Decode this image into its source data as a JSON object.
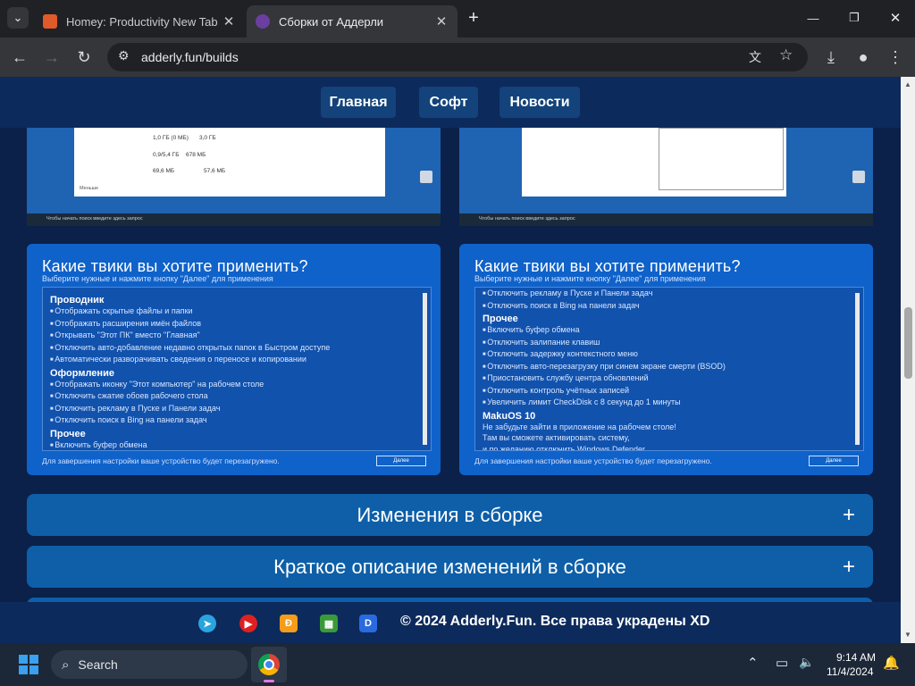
{
  "browser": {
    "tabs": [
      {
        "title": "Homey: Productivity New Tab"
      },
      {
        "title": "Сборки от Аддерли"
      }
    ],
    "url": "adderly.fun/builds"
  },
  "nav": {
    "items": [
      "Главная",
      "Софт",
      "Новости"
    ]
  },
  "screenshots_top": {
    "left": {
      "stats": [
        "1,0 ГБ (0 МБ)",
        "3,0 ГБ",
        "0,9/5,4 ГБ",
        "678 МБ",
        "69,6 МБ",
        "57,6 МБ"
      ],
      "link": "Меньше",
      "search_text": "Чтобы начать поиск введите здесь запрос"
    },
    "right": {
      "search_text": "Чтобы начать поиск введите здесь запрос"
    }
  },
  "cards": [
    {
      "title": "Какие твики вы хотите применить?",
      "subtitle": "Выберите нужные и нажмите кнопку \"Далее\" для применения",
      "sections": [
        {
          "heading": "Проводник",
          "items": [
            "Отображать скрытые файлы и папки",
            "Отображать расширения имён файлов",
            "Открывать \"Этот ПК\" вместо \"Главная\"",
            "Отключить авто-добавление недавно открытых папок в Быстром доступе",
            "Автоматически разворачивать сведения о переносе и копировании"
          ]
        },
        {
          "heading": "Оформление",
          "items": [
            "Отображать иконку \"Этот компьютер\" на рабочем столе",
            "Отключить сжатие обоев рабочего стола",
            "Отключить рекламу в Пуске и Панели задач",
            "Отключить поиск в Bing на панели задач"
          ]
        },
        {
          "heading": "Прочее",
          "items": [
            "Включить буфер обмена"
          ]
        }
      ],
      "footer": "Для завершения настройки ваше устройство будет перезагружено.",
      "next": "Далее"
    },
    {
      "title": "Какие твики вы хотите применить?",
      "subtitle": "Выберите нужные и нажмите кнопку \"Далее\" для применения",
      "top_items": [
        "Отключить рекламу в Пуске и Панели задач",
        "Отключить поиск в Bing на панели задач"
      ],
      "sections": [
        {
          "heading": "Прочее",
          "items": [
            "Включить буфер обмена",
            "Отключить залипание клавиш",
            "Отключить задержку контекстного меню",
            "Отключить авто-перезагрузку при синем экране смерти (BSOD)",
            "Приостановить службу центра обновлений",
            "Отключить контроль учётных записей",
            "Увеличить лимит CheckDisk с 8 секунд до 1 минуты"
          ]
        }
      ],
      "extra_heading": "MakuOS 10",
      "extra_lines": [
        "Не забудьте зайти в приложение на рабочем столе!",
        "Там вы сможете активировать систему,",
        "и по желанию отключить Windows Defender"
      ],
      "footer": "Для завершения настройки ваше устройство будет перезагружено.",
      "next": "Далее"
    }
  ],
  "accordions": [
    {
      "label": "Изменения в сборке",
      "icon": "+"
    },
    {
      "label": "Краткое описание изменений в сборке",
      "icon": "+"
    }
  ],
  "footer": {
    "copyright": "© 2024 Adderly.Fun. Все права украдены XD",
    "social": [
      "telegram-icon",
      "youtube-icon",
      "donationalerts-icon",
      "boosty-icon",
      "d-icon"
    ]
  },
  "os_taskbar": {
    "search": "Search",
    "time": "9:14 AM",
    "date": "11/4/2024"
  },
  "colors": {
    "page_bg": "#0b2149",
    "nav_button": "#13437a",
    "card_bg": "#0f62c9",
    "accordion": "#0e5fa8"
  }
}
